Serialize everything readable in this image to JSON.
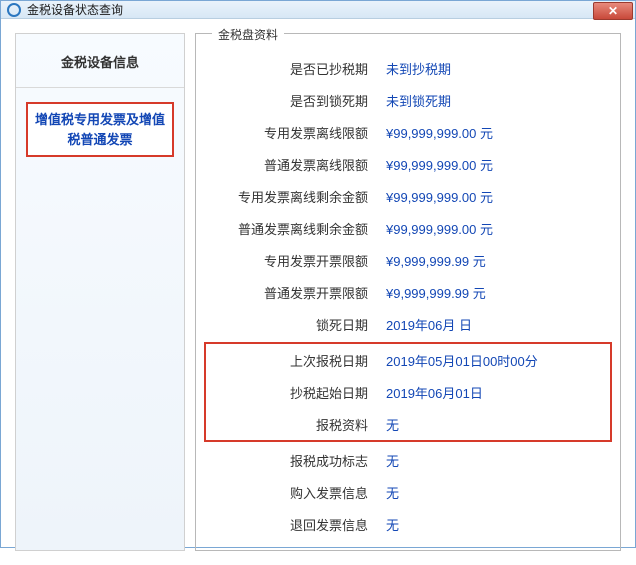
{
  "window": {
    "title": "金税设备状态查询"
  },
  "left": {
    "header": "金税设备信息",
    "item": "增值税专用发票及增值税普通发票"
  },
  "panel": {
    "legend": "金税盘资料"
  },
  "rows": [
    {
      "label": "是否已抄税期",
      "value": "未到抄税期"
    },
    {
      "label": "是否到锁死期",
      "value": "未到锁死期"
    },
    {
      "label": "专用发票离线限额",
      "value": "¥99,999,999.00 元"
    },
    {
      "label": "普通发票离线限额",
      "value": "¥99,999,999.00 元"
    },
    {
      "label": "专用发票离线剩余金额",
      "value": "¥99,999,999.00 元"
    },
    {
      "label": "普通发票离线剩余金额",
      "value": "¥99,999,999.00 元"
    },
    {
      "label": "专用发票开票限额",
      "value": "¥9,999,999.99 元"
    },
    {
      "label": "普通发票开票限额",
      "value": "¥9,999,999.99 元"
    },
    {
      "label": "锁死日期",
      "value": "2019年06月  日"
    }
  ],
  "highlightRows": [
    {
      "label": "上次报税日期",
      "value": "2019年05月01日00时00分"
    },
    {
      "label": "抄税起始日期",
      "value": "2019年06月01日"
    },
    {
      "label": "报税资料",
      "value": "无"
    }
  ],
  "rowsAfter": [
    {
      "label": "报税成功标志",
      "value": "无"
    },
    {
      "label": "购入发票信息",
      "value": "无"
    },
    {
      "label": "退回发票信息",
      "value": "无"
    }
  ]
}
